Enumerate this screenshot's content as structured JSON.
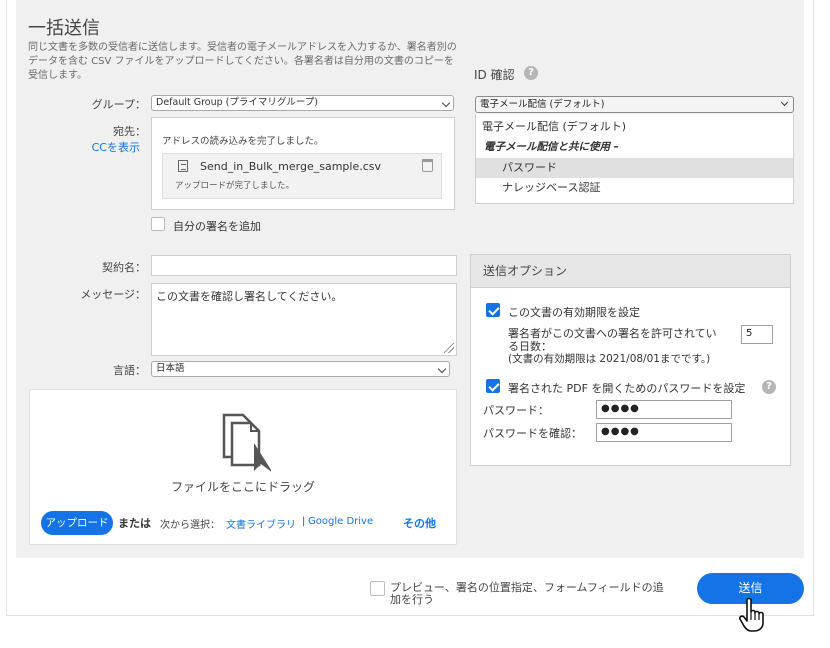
{
  "page": {
    "title": "一括送信",
    "description": "同じ文書を多数の受信者に送信します。受信者の電子メールアドレスを入力するか、署名者別のデータを含む CSV ファイルをアップロードしてください。各署名者は自分用の文書のコピーを受信します。"
  },
  "group": {
    "label": "グループ：",
    "value": "Default Group (プライマリグループ)"
  },
  "recipients": {
    "label": "宛先：",
    "cc_link": "CCを表示",
    "status_message": "アドレスの読み込みを完了しました。",
    "file_name": "Send_in_Bulk_merge_sample.csv",
    "file_status": "アップロードが完了しました。"
  },
  "add_signature": {
    "label": "自分の署名を追加",
    "checked": false
  },
  "agreement": {
    "label": "契約名：",
    "value": ""
  },
  "message": {
    "label": "メッセージ：",
    "value": "この文書を確認し署名してください。"
  },
  "language": {
    "label": "言語：",
    "value": "日本語"
  },
  "dropzone": {
    "drag_text": "ファイルをここにドラッグ",
    "upload_button": "アップロード",
    "or_text": "または",
    "choose_text": "次から選択：",
    "library_link": "文書ライブラリ",
    "separator": "|",
    "google_link": "Google Drive",
    "more_link": "その他"
  },
  "id_verification": {
    "label": "ID 確認",
    "help": "?",
    "selected": "電子メール配信 (デフォルト)",
    "options": [
      {
        "label": "電子メール配信 (デフォルト)",
        "type": "option"
      },
      {
        "label": "電子メール配信と共に使用 –",
        "type": "group"
      },
      {
        "label": "パスワード",
        "type": "option",
        "selected": true
      },
      {
        "label": "ナレッジベース認証",
        "type": "option"
      }
    ]
  },
  "send_options": {
    "header": "送信オプション",
    "expiry_label": "この文書の有効期限を設定",
    "expiry_checked": true,
    "days_label_line1": "署名者がこの文書への署名を許可されてい",
    "days_label_line2": "る日数：",
    "days_value": "5",
    "expiry_note": "(文書の有効期限は 2021/08/01までです。)",
    "pdf_password_label": "署名された PDF を開くためのパスワードを設定",
    "pdf_password_checked": true,
    "help": "?",
    "password_label": "パスワード：",
    "password_value": "●●●●",
    "confirm_label": "パスワードを確認：",
    "confirm_value": "●●●●"
  },
  "footer": {
    "preview_label": "プレビュー、署名の位置指定、フォームフィールドの追加を行う",
    "preview_checked": false,
    "send_button": "送信"
  },
  "colors": {
    "accent": "#1473e6",
    "panel_bg": "#f0f0f0"
  }
}
